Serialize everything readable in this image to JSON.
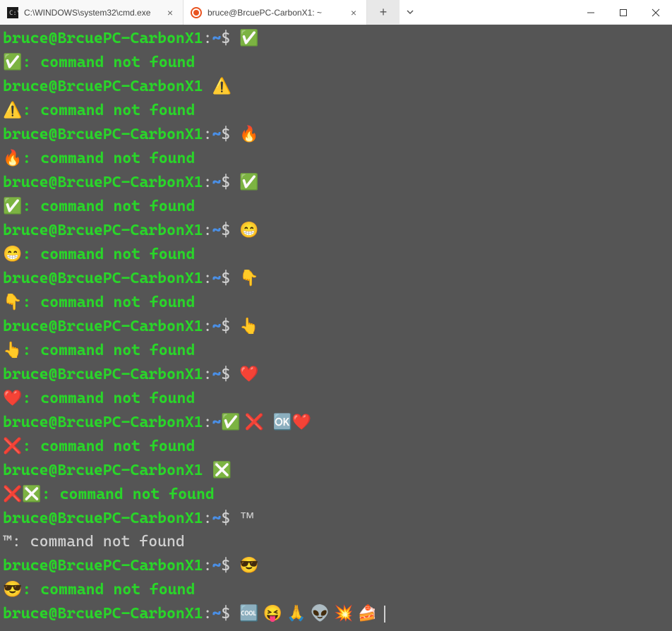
{
  "tabs": [
    {
      "label": "C:\\WINDOWS\\system32\\cmd.exe",
      "active": false,
      "icon": "cmd"
    },
    {
      "label": "bruce@BrcuePC-CarbonX1: ~",
      "active": true,
      "icon": "ubuntu"
    }
  ],
  "prompt": {
    "userhost": "bruce@BrcuePC-CarbonX1",
    "path": "~",
    "sep": ":",
    "sigil": "$"
  },
  "not_found_suffix": ": command not found",
  "lines": [
    {
      "type": "prompt",
      "cmd": "✅"
    },
    {
      "type": "error",
      "lead": "✅"
    },
    {
      "type": "prompt_nopath",
      "cmd": "⚠️"
    },
    {
      "type": "error",
      "lead": "⚠️"
    },
    {
      "type": "prompt",
      "cmd": "🔥"
    },
    {
      "type": "error",
      "lead": "🔥"
    },
    {
      "type": "prompt",
      "cmd": "✅"
    },
    {
      "type": "error",
      "lead": "✅"
    },
    {
      "type": "prompt",
      "cmd": "😁"
    },
    {
      "type": "error",
      "lead": "😁"
    },
    {
      "type": "prompt",
      "cmd": "👇"
    },
    {
      "type": "error",
      "lead": "👇"
    },
    {
      "type": "prompt",
      "cmd": "👆"
    },
    {
      "type": "error",
      "lead": "👆"
    },
    {
      "type": "prompt",
      "cmd": "❤️"
    },
    {
      "type": "error",
      "lead": "❤️"
    },
    {
      "type": "prompt_custom",
      "after_path": "~",
      "cmd": "✅ ❌  🆗❤️"
    },
    {
      "type": "error",
      "lead": "❌"
    },
    {
      "type": "prompt_nopath",
      "cmd": "❎"
    },
    {
      "type": "error",
      "lead": "❌❎"
    },
    {
      "type": "prompt",
      "cmd": "™"
    },
    {
      "type": "error_plain",
      "lead": "™"
    },
    {
      "type": "prompt",
      "cmd": "😎"
    },
    {
      "type": "error",
      "lead": "😎"
    },
    {
      "type": "prompt_cursor",
      "cmd": "🆒 😝 🙏 👽 💥 🍰 "
    }
  ]
}
